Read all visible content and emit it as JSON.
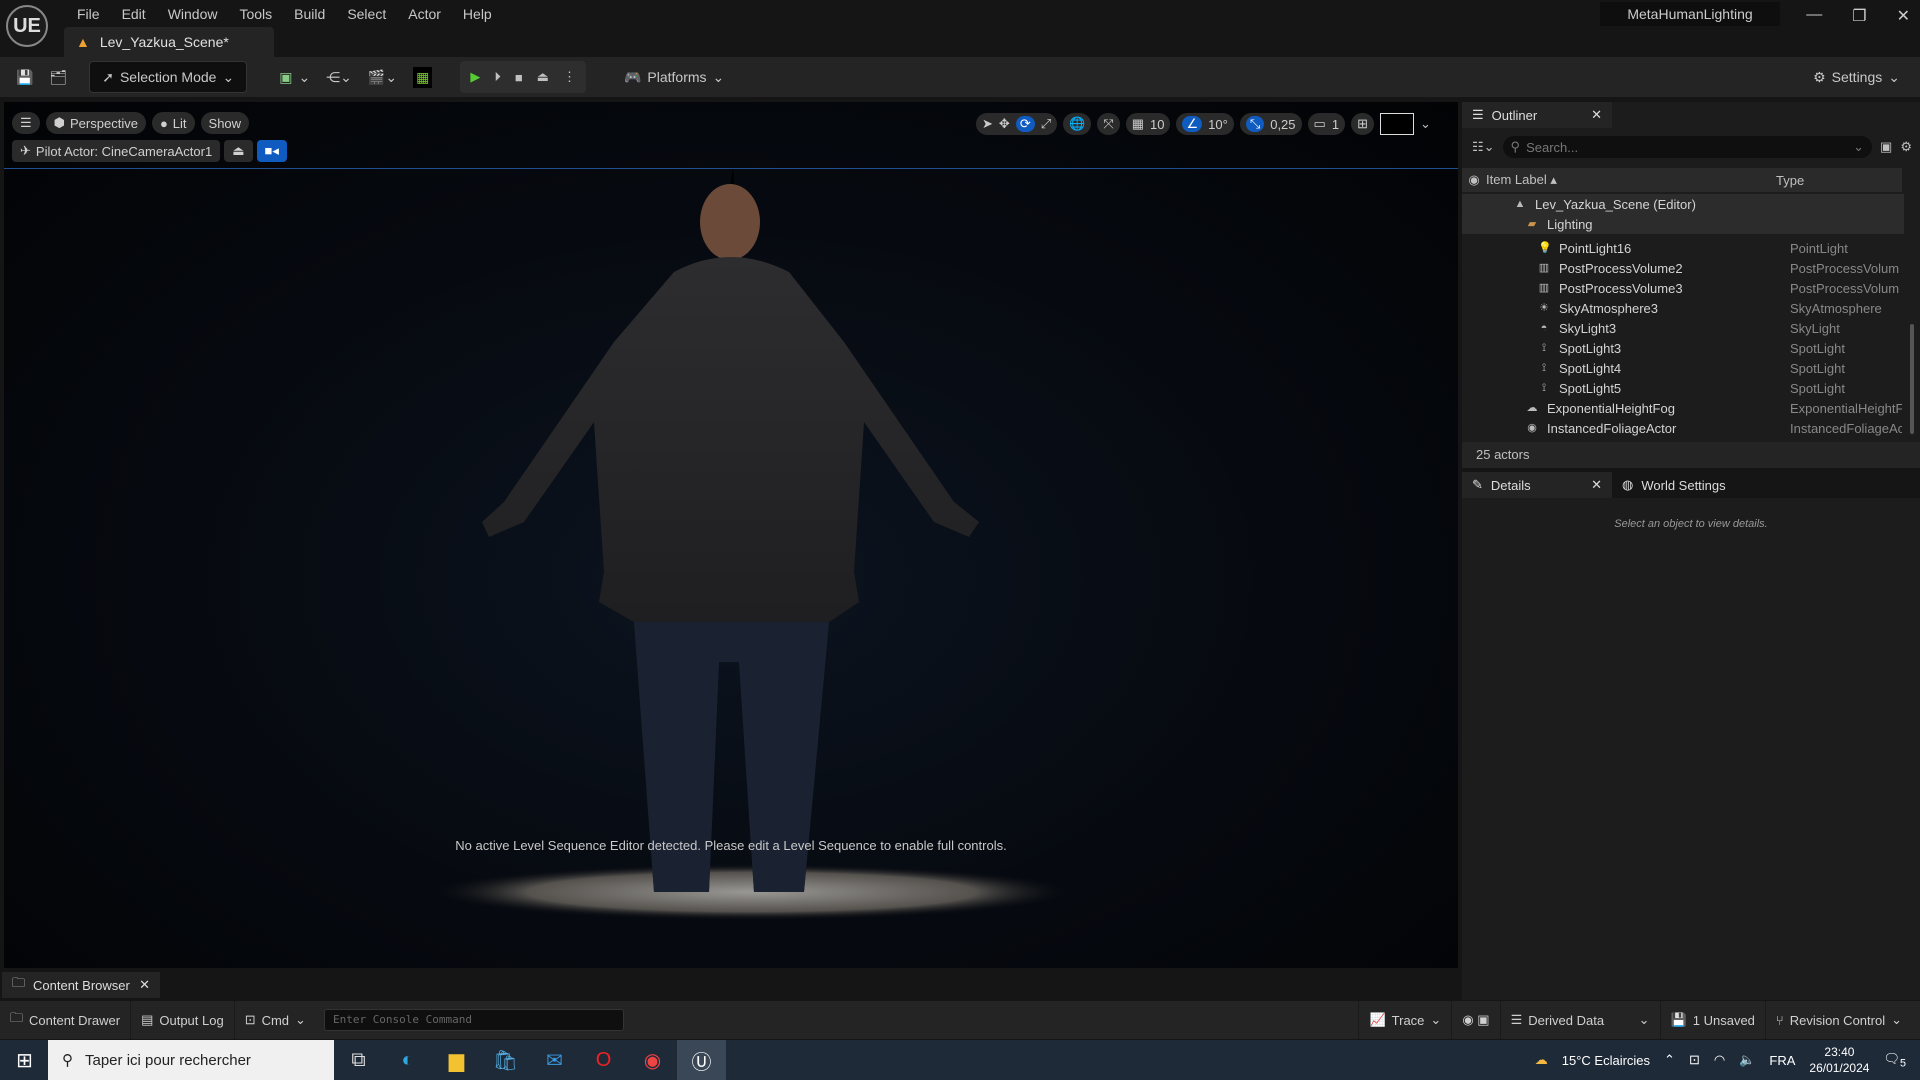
{
  "app": {
    "title": "MetaHumanLighting",
    "logo": "UE",
    "menu": [
      "File",
      "Edit",
      "Window",
      "Tools",
      "Build",
      "Select",
      "Actor",
      "Help"
    ],
    "document_tab": "Lev_Yazkua_Scene*"
  },
  "toolbar": {
    "selection_mode": "Selection Mode",
    "platforms": "Platforms",
    "settings": "Settings"
  },
  "viewport": {
    "perspective": "Perspective",
    "lit": "Lit",
    "show": "Show",
    "pilot": "Pilot Actor: CineCameraActor1",
    "grid_snap": "10",
    "rotation_snap": "10°",
    "scale_snap": "0,25",
    "camera_speed": "1",
    "message": "No active Level Sequence Editor detected. Please edit a Level Sequence to enable full controls."
  },
  "outliner": {
    "tab": "Outliner",
    "search_placeholder": "Search...",
    "col_label": "Item Label",
    "col_type": "Type",
    "rows": [
      {
        "label": "Lev_Yazkua_Scene (Editor)",
        "type": "",
        "indent": 0,
        "icon": "level-icon"
      },
      {
        "label": "Lighting",
        "type": "",
        "indent": 1,
        "icon": "folder-icon"
      },
      {
        "label": "PointLight16",
        "type": "PointLight",
        "indent": 2,
        "icon": "pointlight-icon"
      },
      {
        "label": "PostProcessVolume2",
        "type": "PostProcessVolum",
        "indent": 2,
        "icon": "postprocess-icon"
      },
      {
        "label": "PostProcessVolume3",
        "type": "PostProcessVolum",
        "indent": 2,
        "icon": "postprocess-icon"
      },
      {
        "label": "SkyAtmosphere3",
        "type": "SkyAtmosphere",
        "indent": 2,
        "icon": "skyatmosphere-icon"
      },
      {
        "label": "SkyLight3",
        "type": "SkyLight",
        "indent": 2,
        "icon": "skylight-icon"
      },
      {
        "label": "SpotLight3",
        "type": "SpotLight",
        "indent": 2,
        "icon": "spotlight-icon"
      },
      {
        "label": "SpotLight4",
        "type": "SpotLight",
        "indent": 2,
        "icon": "spotlight-icon"
      },
      {
        "label": "SpotLight5",
        "type": "SpotLight",
        "indent": 2,
        "icon": "spotlight-icon"
      },
      {
        "label": "ExponentialHeightFog",
        "type": "ExponentialHeightF",
        "indent": 1,
        "icon": "fog-icon"
      },
      {
        "label": "InstancedFoliageActor",
        "type": "InstancedFoliageAc",
        "indent": 1,
        "icon": "foliage-icon"
      }
    ],
    "count": "25 actors"
  },
  "details": {
    "tab": "Details",
    "world_tab": "World Settings",
    "empty": "Select an object to view details."
  },
  "bottom": {
    "content_browser": "Content Browser",
    "content_drawer": "Content Drawer",
    "output_log": "Output Log",
    "cmd": "Cmd",
    "console_placeholder": "Enter Console Command",
    "trace": "Trace",
    "derived_data": "Derived Data",
    "unsaved": "1 Unsaved",
    "revision": "Revision Control"
  },
  "taskbar": {
    "search": "Taper ici pour rechercher",
    "weather": "15°C  Eclaircies",
    "lang": "FRA",
    "time": "23:40",
    "date": "26/01/2024",
    "notifications": "5"
  }
}
